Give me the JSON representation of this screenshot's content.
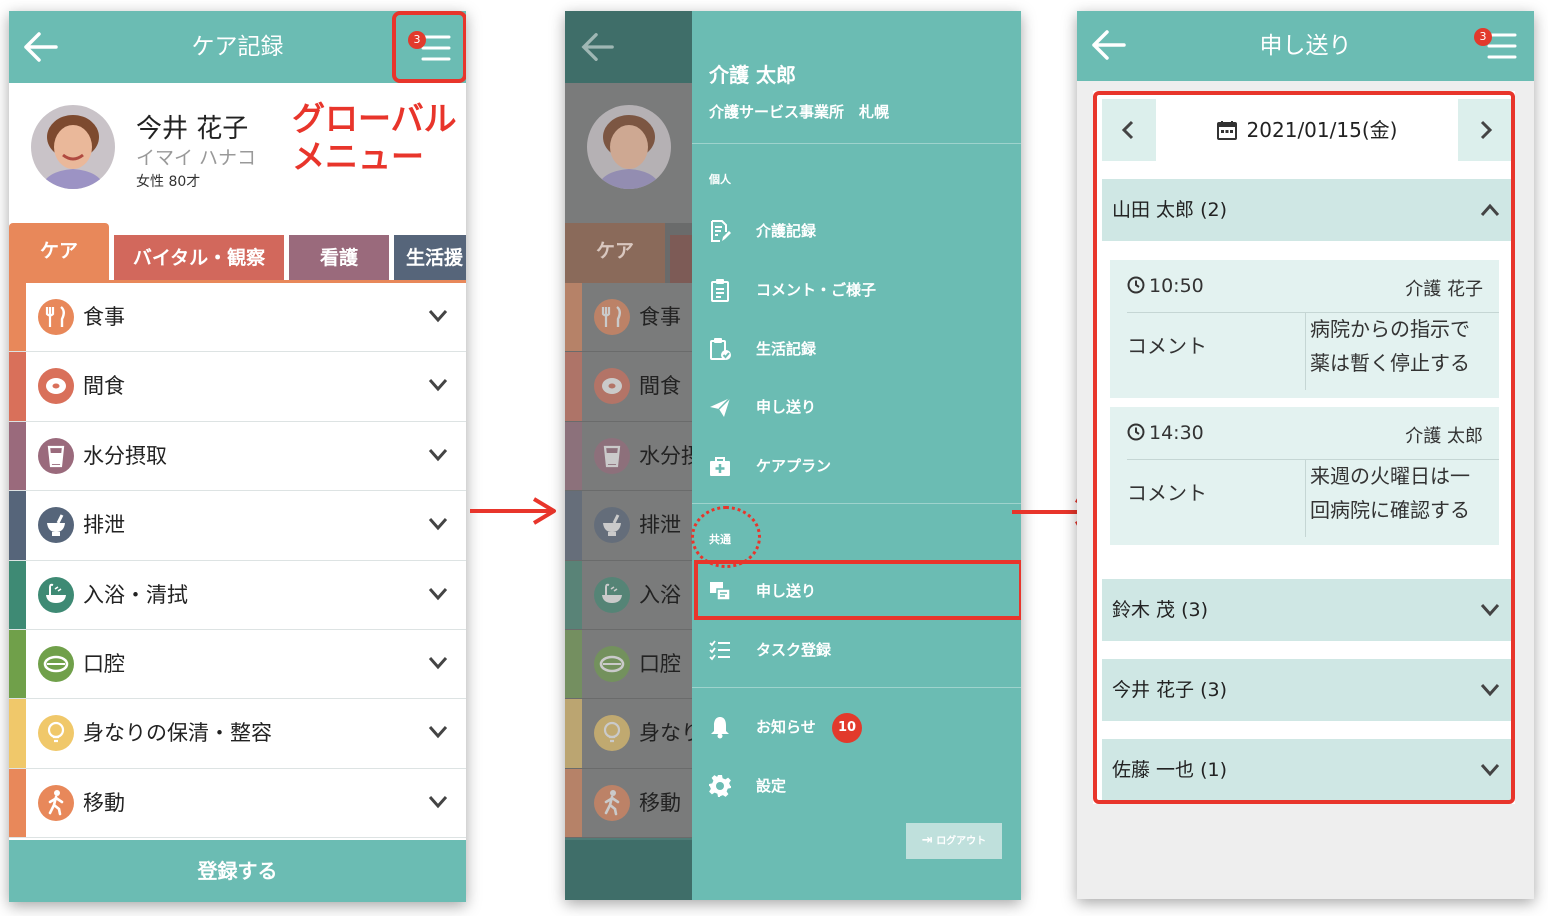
{
  "screen1": {
    "title": "ケア記録",
    "menu_badge": "3",
    "resident": {
      "name": "今井 花子",
      "kana": "イマイ ハナコ",
      "info": "女性 80才"
    },
    "annotation": "グローバルメニュー",
    "tabs": [
      "ケア",
      "バイタル・観察",
      "看護",
      "生活援"
    ],
    "categories": [
      {
        "label": "食事",
        "icon": "fork-knife-icon",
        "color": "#e8885a"
      },
      {
        "label": "間食",
        "icon": "donut-icon",
        "color": "#d9705a"
      },
      {
        "label": "水分摂取",
        "icon": "cup-icon",
        "color": "#9a6a7c"
      },
      {
        "label": "排泄",
        "icon": "toilet-icon",
        "color": "#56657a"
      },
      {
        "label": "入浴・清拭",
        "icon": "bath-icon",
        "color": "#3e8a74"
      },
      {
        "label": "口腔",
        "icon": "mouth-icon",
        "color": "#70a04a"
      },
      {
        "label": "身なりの保清・整容",
        "icon": "lightbulb-icon",
        "color": "#f0c86a"
      },
      {
        "label": "移動",
        "icon": "walk-icon",
        "color": "#e8885a"
      }
    ],
    "submit_label": "登録する"
  },
  "screen2": {
    "user_name": "介護 太郎",
    "office": "介護サービス事業所　札幌",
    "section_personal": "個人",
    "personal_items": [
      {
        "label": "介護記録",
        "icon": "document-edit-icon"
      },
      {
        "label": "コメント・ご様子",
        "icon": "clipboard-icon"
      },
      {
        "label": "生活記録",
        "icon": "clipboard-check-icon"
      },
      {
        "label": "申し送り",
        "icon": "paper-plane-icon"
      },
      {
        "label": "ケアプラン",
        "icon": "medical-bag-icon"
      }
    ],
    "section_common": "共通",
    "common_items": [
      {
        "label": "申し送り",
        "icon": "handover-icon"
      },
      {
        "label": "タスク登録",
        "icon": "task-list-icon"
      }
    ],
    "notice_label": "お知らせ",
    "notice_badge": "10",
    "settings_label": "設定",
    "logout_label": "ログアウト",
    "bg_categories": [
      "食事",
      "間食",
      "水分摂",
      "排泄",
      "入浴",
      "口腔",
      "身なり",
      "移動"
    ],
    "bg_tab": "ケア"
  },
  "screen3": {
    "title": "申し送り",
    "menu_badge": "3",
    "date": "2021/01/15(金)",
    "groups": [
      {
        "label": "山田 太郎 (2)",
        "expanded": true
      },
      {
        "label": "鈴木 茂 (3)",
        "expanded": false
      },
      {
        "label": "今井 花子 (3)",
        "expanded": false
      },
      {
        "label": "佐藤 一也 (1)",
        "expanded": false
      }
    ],
    "entries": [
      {
        "time": "10:50",
        "author": "介護 花子",
        "type": "コメント",
        "text_line1": "病院からの指示で",
        "text_line2": "薬は暫く停止する"
      },
      {
        "time": "14:30",
        "author": "介護 太郎",
        "type": "コメント",
        "text_line1": "来週の火曜日は一",
        "text_line2": "回病院に確認する"
      }
    ]
  },
  "colors": {
    "teal": "#6bbcb3",
    "highlight": "#e8352b",
    "badge": "#e23a2c"
  }
}
